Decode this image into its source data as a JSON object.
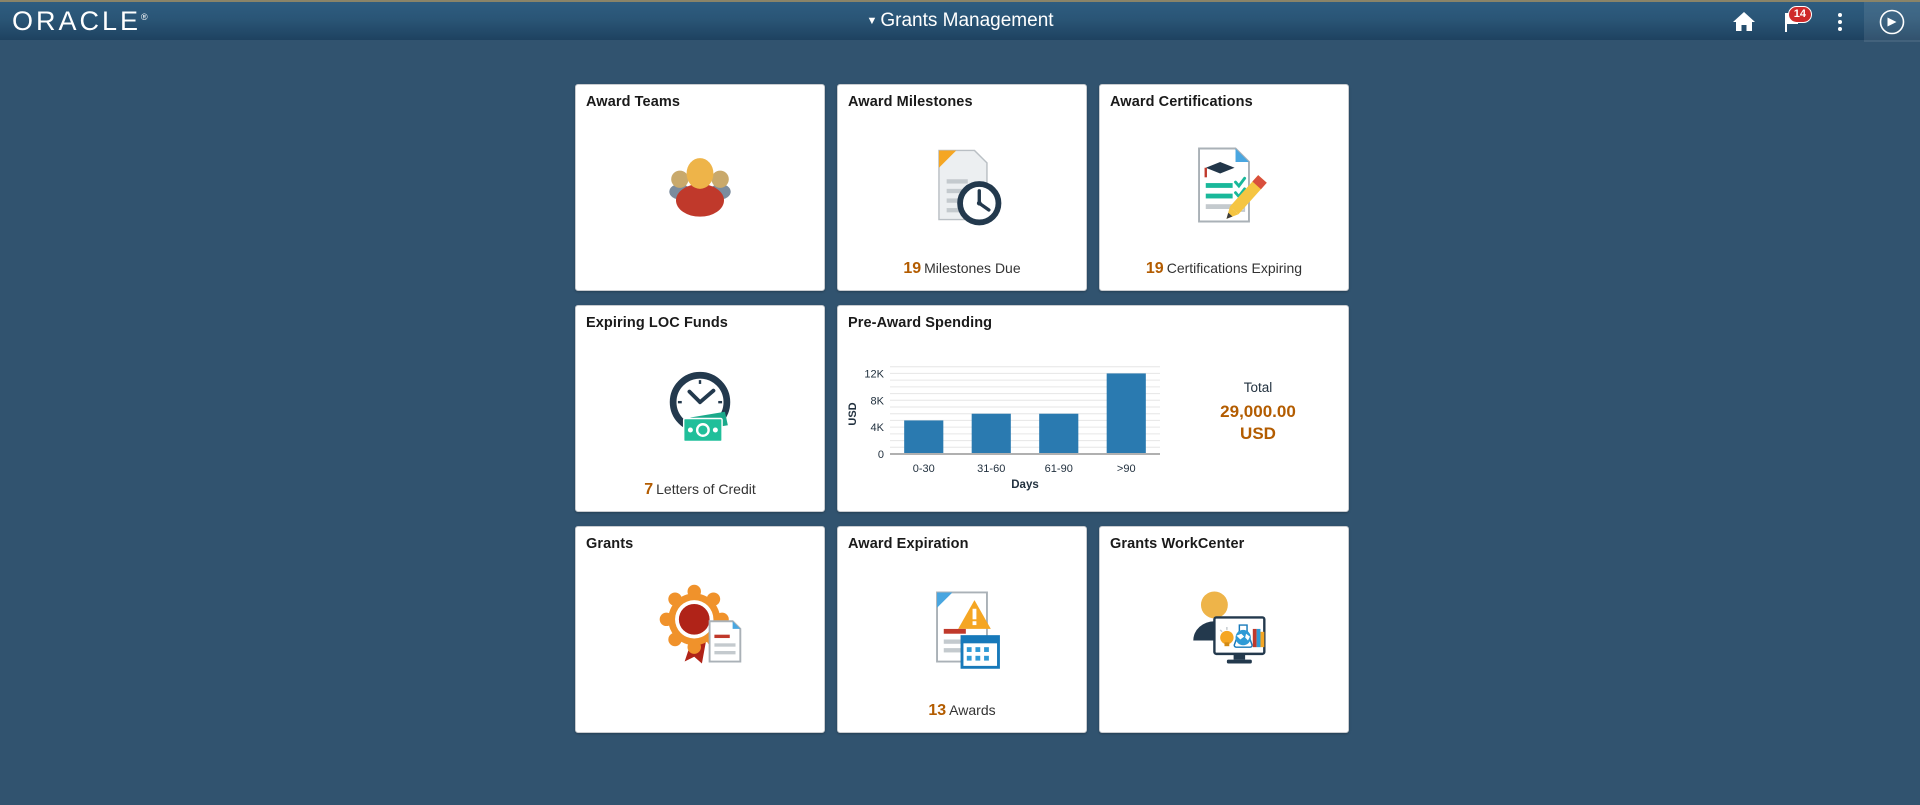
{
  "header": {
    "logo_text": "ORACLE",
    "logo_reg": "®",
    "title": "Grants Management",
    "caret": "▼",
    "home_icon": "home-icon",
    "notifications_icon": "flag-icon",
    "notifications_count": "14",
    "actions_icon": "three-dot-menu-icon",
    "navbar_icon": "compass-navbar-icon"
  },
  "tiles": [
    {
      "title": "Award Teams",
      "icon": "team-people-icon",
      "count": "",
      "label": ""
    },
    {
      "title": "Award Milestones",
      "icon": "document-clock-icon",
      "count": "19",
      "label": "Milestones Due"
    },
    {
      "title": "Award Certifications",
      "icon": "certificate-checklist-pencil-icon",
      "count": "19",
      "label": "Certifications Expiring"
    },
    {
      "title": "Expiring LOC Funds",
      "icon": "clock-money-icon",
      "count": "7",
      "label": "Letters of Credit"
    },
    {
      "title": "Pre-Award Spending",
      "icon": "bar-chart-icon",
      "count": "",
      "label": ""
    },
    {
      "title": "Grants",
      "icon": "award-rosette-document-icon",
      "count": "",
      "label": ""
    },
    {
      "title": "Award Expiration",
      "icon": "document-warning-calendar-icon",
      "count": "13",
      "label": "Awards"
    },
    {
      "title": "Grants WorkCenter",
      "icon": "person-monitor-research-icon",
      "count": "",
      "label": ""
    }
  ],
  "pre_award": {
    "total_label": "Total",
    "total_value": "29,000.00",
    "total_currency": "USD"
  },
  "chart_data": {
    "type": "bar",
    "title": "Pre-Award Spending",
    "categories": [
      "0-30",
      "31-60",
      "61-90",
      ">90"
    ],
    "values": [
      5000,
      6000,
      6000,
      12000
    ],
    "xlabel": "Days",
    "ylabel": "USD",
    "ylim": [
      0,
      14000
    ],
    "ytick_values": [
      0,
      4000,
      8000,
      12000
    ],
    "ytick_labels": [
      "0",
      "4K",
      "8K",
      "12K"
    ],
    "grid": true,
    "legend": false,
    "bar_color": "#2a7ab0",
    "total": 29000,
    "currency": "USD"
  },
  "colors": {
    "page_background": "#31536f",
    "header_gradient_top": "#2e5d80",
    "header_gradient_bottom": "#1e4260",
    "accent_orange": "#b35c00",
    "badge_red": "#cf2a2a",
    "bar_blue": "#2a7ab0"
  }
}
